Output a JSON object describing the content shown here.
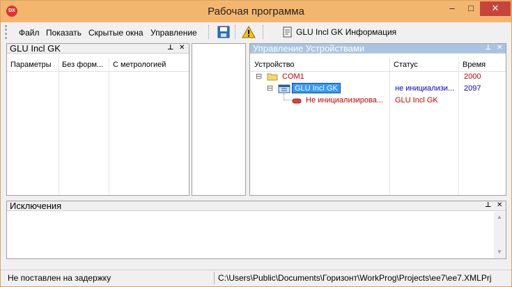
{
  "window": {
    "title": "Рабочая программа",
    "app_icon_text": "DX",
    "controls": {
      "minimize": "–",
      "maximize": "□",
      "close": "✕"
    }
  },
  "menu": {
    "items": [
      "Файл",
      "Показать",
      "Скрытые окна",
      "Управление"
    ],
    "info_button": "GLU Incl GK Информация"
  },
  "left_panel": {
    "title": "GLU Incl GK",
    "columns": [
      "Параметры",
      "Без форм...",
      "С метрологией"
    ]
  },
  "devices_panel": {
    "title": "Управление Устройствами",
    "columns": [
      "Устройство",
      "Статус",
      "Время"
    ],
    "rows": [
      {
        "expander": "⊟",
        "name": "COM1",
        "status": "",
        "time": "2000",
        "color": "#c00000"
      },
      {
        "expander": "⊟",
        "name": "GLU Incl GK",
        "status": "не инициализи...",
        "time": "2097",
        "color": "#0000c0"
      },
      {
        "expander": "",
        "name": "Не инициализирова...",
        "status": "GLU Incl GK",
        "time": "",
        "color": "#c00000"
      }
    ]
  },
  "exceptions_panel": {
    "title": "Исключения"
  },
  "panel_controls": {
    "pin": "📌",
    "close": "✕"
  },
  "statusbar": {
    "left": "Не поставлен на задержку",
    "path": "C:\\Users\\Public\\Documents\\Горизонт\\WorkProg\\Projects\\ee7\\ee7.XMLPrj"
  },
  "colors": {
    "titlebar": "#f3b66f",
    "close_button": "#c7443a",
    "active_panel_head": "#a9c4e3",
    "selected_row": "#3399ff"
  }
}
